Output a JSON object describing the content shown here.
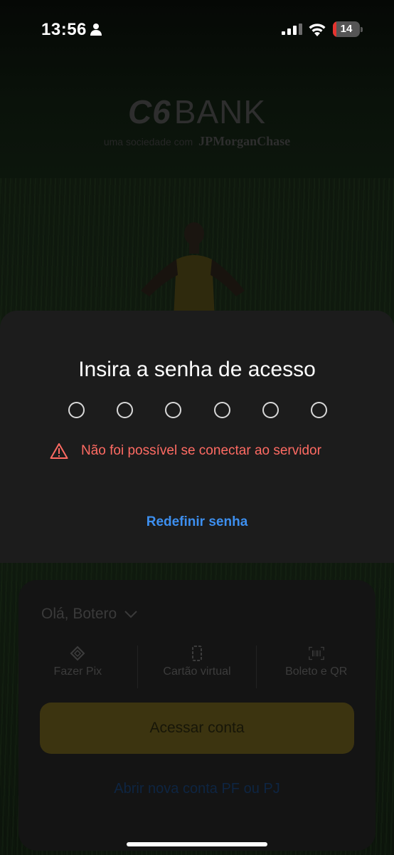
{
  "status_bar": {
    "time": "13:56",
    "battery_level": "14",
    "battery_fraction": 0.14,
    "battery_color": "#e5342f",
    "icons": [
      "person-icon",
      "signal-icon",
      "wifi-icon",
      "battery-icon"
    ]
  },
  "brand": {
    "logo_c6": "C6",
    "logo_bank": "BANK",
    "tagline": "uma sociedade com",
    "partner": "JPMorganChase"
  },
  "password_sheet": {
    "title": "Insira a senha de acesso",
    "pin_length": 6,
    "error_message": "Não foi possível se conectar ao servidor",
    "error_color": "#ff6b63",
    "reset_link": "Redefinir senha",
    "link_color": "#3d8fef"
  },
  "home_card": {
    "greeting": "Olá, Botero",
    "quick_actions": [
      {
        "label": "Fazer Pix",
        "icon": "pix-icon"
      },
      {
        "label": "Cartão virtual",
        "icon": "card-icon"
      },
      {
        "label": "Boleto e QR",
        "icon": "barcode-icon"
      }
    ],
    "access_button": "Acessar conta",
    "open_account_link": "Abrir nova conta PF ou PJ"
  }
}
